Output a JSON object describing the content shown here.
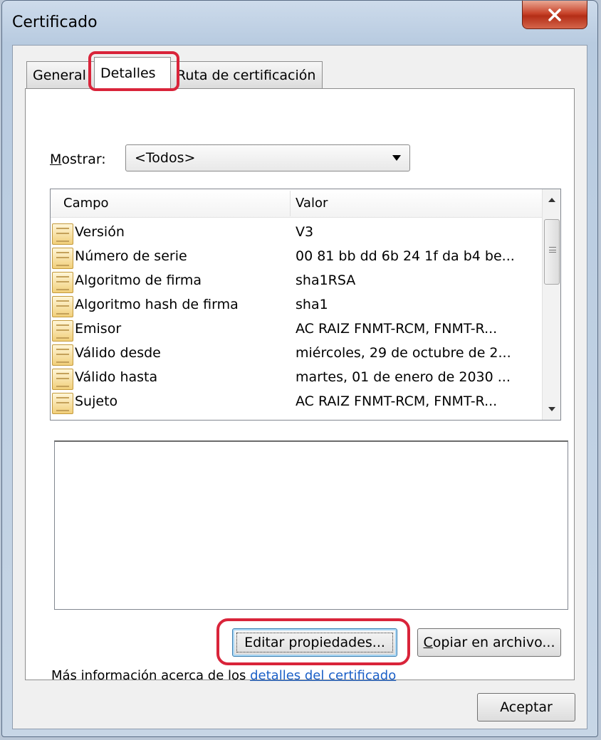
{
  "window": {
    "title": "Certificado",
    "close_glyph": "X"
  },
  "tabs": [
    {
      "label": "General",
      "active": false
    },
    {
      "label": "Detalles",
      "active": true
    },
    {
      "label": "Ruta de certificación",
      "active": false
    }
  ],
  "filter": {
    "label_accel": "M",
    "label_rest": "ostrar:",
    "selected": "<Todos>"
  },
  "list": {
    "columns": [
      "Campo",
      "Valor"
    ],
    "rows": [
      {
        "field": "Versión",
        "value": "V3"
      },
      {
        "field": "Número de serie",
        "value": "00 81 bb dd 6b 24 1f da b4 be..."
      },
      {
        "field": "Algoritmo de firma",
        "value": "sha1RSA"
      },
      {
        "field": "Algoritmo hash de firma",
        "value": "sha1"
      },
      {
        "field": "Emisor",
        "value": "AC RAIZ FNMT-RCM, FNMT-R..."
      },
      {
        "field": "Válido desde",
        "value": "miércoles, 29 de octubre de 2..."
      },
      {
        "field": "Válido hasta",
        "value": "martes, 01 de enero de 2030 ..."
      },
      {
        "field": "Sujeto",
        "value": "AC RAIZ FNMT-RCM, FNMT-R..."
      }
    ]
  },
  "buttons": {
    "edit_properties": "Editar propiedades...",
    "copy_to_file_accel": "C",
    "copy_to_file_rest": "opiar en archivo...",
    "accept": "Aceptar"
  },
  "info": {
    "text": "Más información acerca de los ",
    "link": "detalles del certificado"
  },
  "colors": {
    "highlight": "#d9243a",
    "link": "#1a5fc7",
    "close_button": "#c9452c"
  }
}
